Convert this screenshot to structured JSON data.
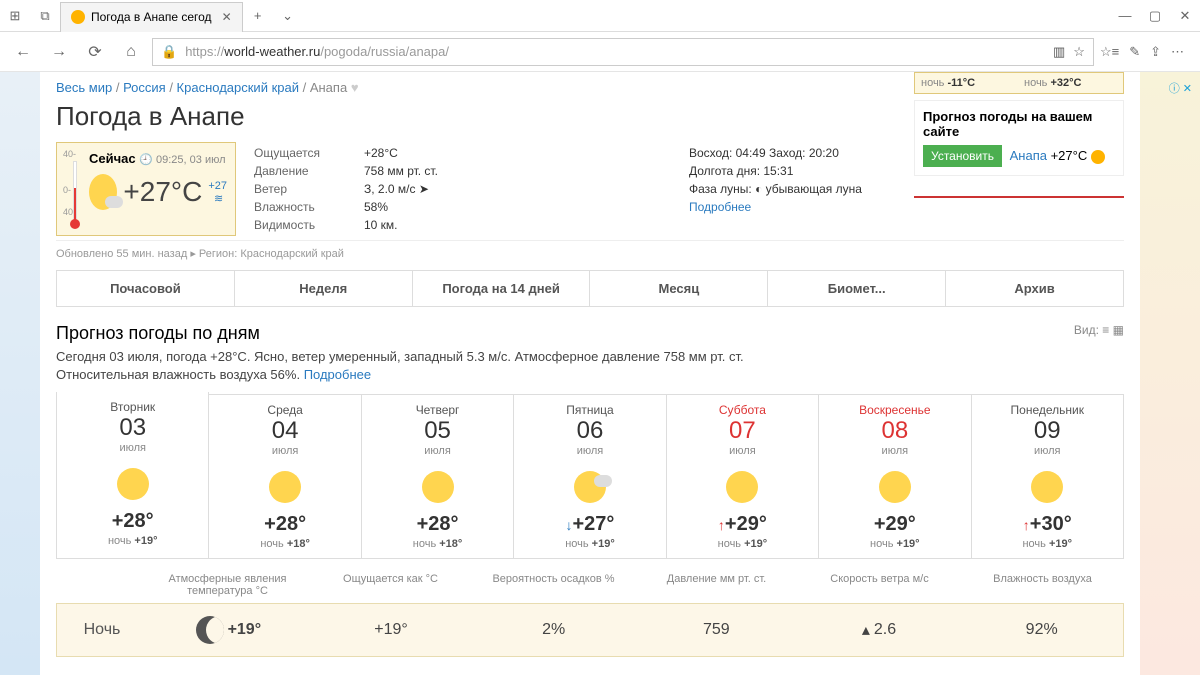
{
  "browser": {
    "tab_title": "Погода в Анапе сегод",
    "url_prefix": "https://",
    "url_host": "world-weather.ru",
    "url_path": "/pogoda/russia/anapa/"
  },
  "breadcrumb": {
    "world": "Весь мир",
    "country": "Россия",
    "region": "Краснодарский край",
    "city": "Анапа"
  },
  "page_title": "Погода в Анапе",
  "records": {
    "night_label": "ночь",
    "night_t": "-11°C",
    "day_label": "ночь",
    "day_t": "+32°C"
  },
  "widget": {
    "title": "Прогноз погоды на вашем сайте",
    "install": "Установить",
    "city": "Анапа",
    "temp": "+27°C"
  },
  "now": {
    "label": "Сейчас",
    "time": "09:25, 03 июл",
    "temp": "+27°C",
    "water": "+27",
    "scale_top": "40-",
    "scale_mid": "0-",
    "scale_bot": "40-",
    "feels_l": "Ощущается",
    "feels_v": "+28°C",
    "press_l": "Давление",
    "press_v": "758 мм рт. ст.",
    "wind_l": "Ветер",
    "wind_v": "З, 2.0 м/с ➤",
    "hum_l": "Влажность",
    "hum_v": "58%",
    "vis_l": "Видимость",
    "vis_v": "10 км.",
    "sun_l": "Восход: 04:49 Заход: 20:20",
    "daylen_l": "Долгота дня: 15:31",
    "moon_l": "Фаза луны: ◐ убывающая луна",
    "more": "Подробнее"
  },
  "updated": "Обновлено 55 мин. назад  ▸ Регион: Краснодарский край",
  "tabs": [
    "Почасовой",
    "Неделя",
    "Погода на 14 дней",
    "Месяц",
    "Биомет...",
    "Архив"
  ],
  "forecast_title": "Прогноз погоды по дням",
  "view_label": "Вид:",
  "summary_text": "Сегодня 03 июля, погода +28°C. Ясно, ветер умеренный, западный 5.3 м/с. Атмосферное давление 758 мм рт. ст. Относительная влажность воздуха 56%. ",
  "summary_more": "Подробнее",
  "days": [
    {
      "dow": "Вторник",
      "num": "03",
      "month": "июля",
      "hi": "+28°",
      "lo": "+19°",
      "weekend": false,
      "cloud": false,
      "trend": ""
    },
    {
      "dow": "Среда",
      "num": "04",
      "month": "июля",
      "hi": "+28°",
      "lo": "+18°",
      "weekend": false,
      "cloud": false,
      "trend": ""
    },
    {
      "dow": "Четверг",
      "num": "05",
      "month": "июля",
      "hi": "+28°",
      "lo": "+18°",
      "weekend": false,
      "cloud": false,
      "trend": ""
    },
    {
      "dow": "Пятница",
      "num": "06",
      "month": "июля",
      "hi": "+27°",
      "lo": "+19°",
      "weekend": false,
      "cloud": true,
      "trend": "down"
    },
    {
      "dow": "Суббота",
      "num": "07",
      "month": "июля",
      "hi": "+29°",
      "lo": "+19°",
      "weekend": true,
      "cloud": false,
      "trend": "up"
    },
    {
      "dow": "Воскресенье",
      "num": "08",
      "month": "июля",
      "hi": "+29°",
      "lo": "+19°",
      "weekend": true,
      "cloud": false,
      "trend": ""
    },
    {
      "dow": "Понедельник",
      "num": "09",
      "month": "июля",
      "hi": "+30°",
      "lo": "+19°",
      "weekend": false,
      "cloud": false,
      "trend": "up"
    }
  ],
  "detail_headers": [
    "Атмосферные явления температура °C",
    "Ощущается как °C",
    "Вероятность осадков %",
    "Давление мм рт. ст.",
    "Скорость ветра м/с",
    "Влажность воздуха"
  ],
  "night_label": "ночь",
  "detail": {
    "label": "Ночь",
    "temp": "+19°",
    "feels": "+19°",
    "precip": "2%",
    "pressure": "759",
    "wind": "2.6",
    "humidity": "92%"
  }
}
